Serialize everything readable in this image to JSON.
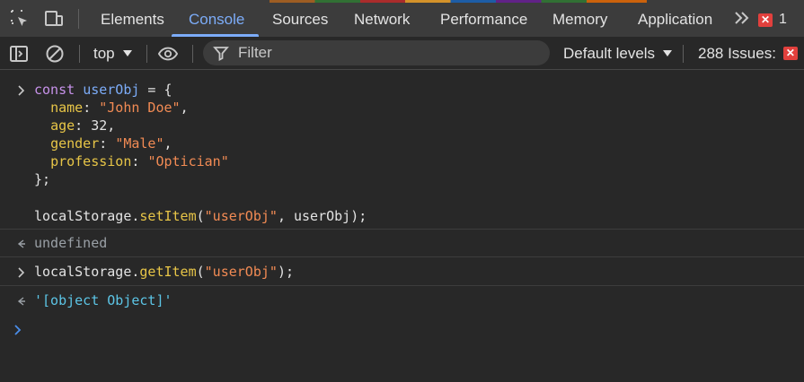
{
  "tabbar": {
    "tabs": [
      {
        "label": "Elements",
        "active": false
      },
      {
        "label": "Console",
        "active": true
      },
      {
        "label": "Sources",
        "active": false
      },
      {
        "label": "Network",
        "active": false
      },
      {
        "label": "Performance",
        "active": false
      },
      {
        "label": "Memory",
        "active": false
      },
      {
        "label": "Application",
        "active": false
      }
    ],
    "more_tabs_icon": "double-chevron-right-icon",
    "error_count": "1"
  },
  "toolbar": {
    "context": "top",
    "filter_placeholder": "Filter",
    "levels": "Default levels",
    "issues_label": "288 Issues:",
    "issues_count": "1"
  },
  "console": {
    "input1": {
      "lines": [
        {
          "keyword": "const",
          "name": "userObj",
          "rest": " = {"
        },
        {
          "indent": "  ",
          "prop": "name",
          "sep": ": ",
          "value": "\"John Doe\"",
          "end": ","
        },
        {
          "indent": "  ",
          "prop": "age",
          "sep": ": ",
          "value": "32",
          "end": ","
        },
        {
          "indent": "  ",
          "prop": "gender",
          "sep": ": ",
          "value": "\"Male\"",
          "end": ","
        },
        {
          "indent": "  ",
          "prop": "profession",
          "sep": ": ",
          "value": "\"Optician\"",
          "end": ""
        },
        {
          "text": "};"
        },
        {
          "text": ""
        },
        {
          "obj": "localStorage.",
          "method": "setItem",
          "open": "(",
          "arg1": "\"userObj\"",
          "mid": ", userObj);"
        }
      ]
    },
    "output1": "undefined",
    "input2": {
      "obj": "localStorage.",
      "method": "getItem",
      "open": "(",
      "arg1": "\"userObj\"",
      "close": ");"
    },
    "output2": "'[object Object]'"
  },
  "colors": {
    "accent": "#7cacf8",
    "error": "#e2403d",
    "background": "#282828",
    "tabbar": "#3c3c3c"
  }
}
